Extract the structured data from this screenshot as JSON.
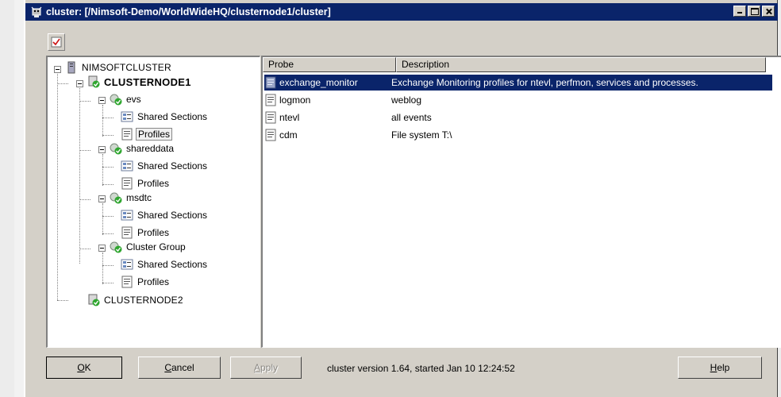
{
  "window": {
    "title": "cluster: [/Nimsoft-Demo/WorldWideHQ/clusternode1/cluster]",
    "app_icon": "nimsoft-robot-icon"
  },
  "toolbar": {
    "button_icon": "checklist-icon"
  },
  "tree": {
    "root": "NIMSOFTCLUSTER",
    "node1": "CLUSTERNODE1",
    "groups": [
      {
        "label": "evs",
        "shared": "Shared Sections",
        "profiles": "Profiles"
      },
      {
        "label": "shareddata",
        "shared": "Shared Sections",
        "profiles": "Profiles"
      },
      {
        "label": "msdtc",
        "shared": "Shared Sections",
        "profiles": "Profiles"
      },
      {
        "label": "Cluster Group",
        "shared": "Shared Sections",
        "profiles": "Profiles"
      }
    ],
    "node2": "CLUSTERNODE2"
  },
  "list": {
    "columns": {
      "probe": "Probe",
      "description": "Description"
    },
    "rows": [
      {
        "probe": "exchange_monitor",
        "description": "Exchange Monitoring profiles for ntevl, perfmon, services and processes.",
        "selected": true
      },
      {
        "probe": "logmon",
        "description": "weblog"
      },
      {
        "probe": "ntevl",
        "description": "all events"
      },
      {
        "probe": "cdm",
        "description": "File system T:\\"
      }
    ]
  },
  "buttons": {
    "ok": {
      "mnemonic": "O",
      "rest": "K"
    },
    "cancel": {
      "mnemonic": "C",
      "rest": "ancel"
    },
    "apply": {
      "mnemonic": "A",
      "rest": "pply"
    },
    "help": {
      "mnemonic": "H",
      "rest": "elp"
    }
  },
  "status": "cluster version 1.64, started Jan 10 12:24:52",
  "colors": {
    "selection": "#0a246a",
    "face": "#d4d0c8"
  }
}
